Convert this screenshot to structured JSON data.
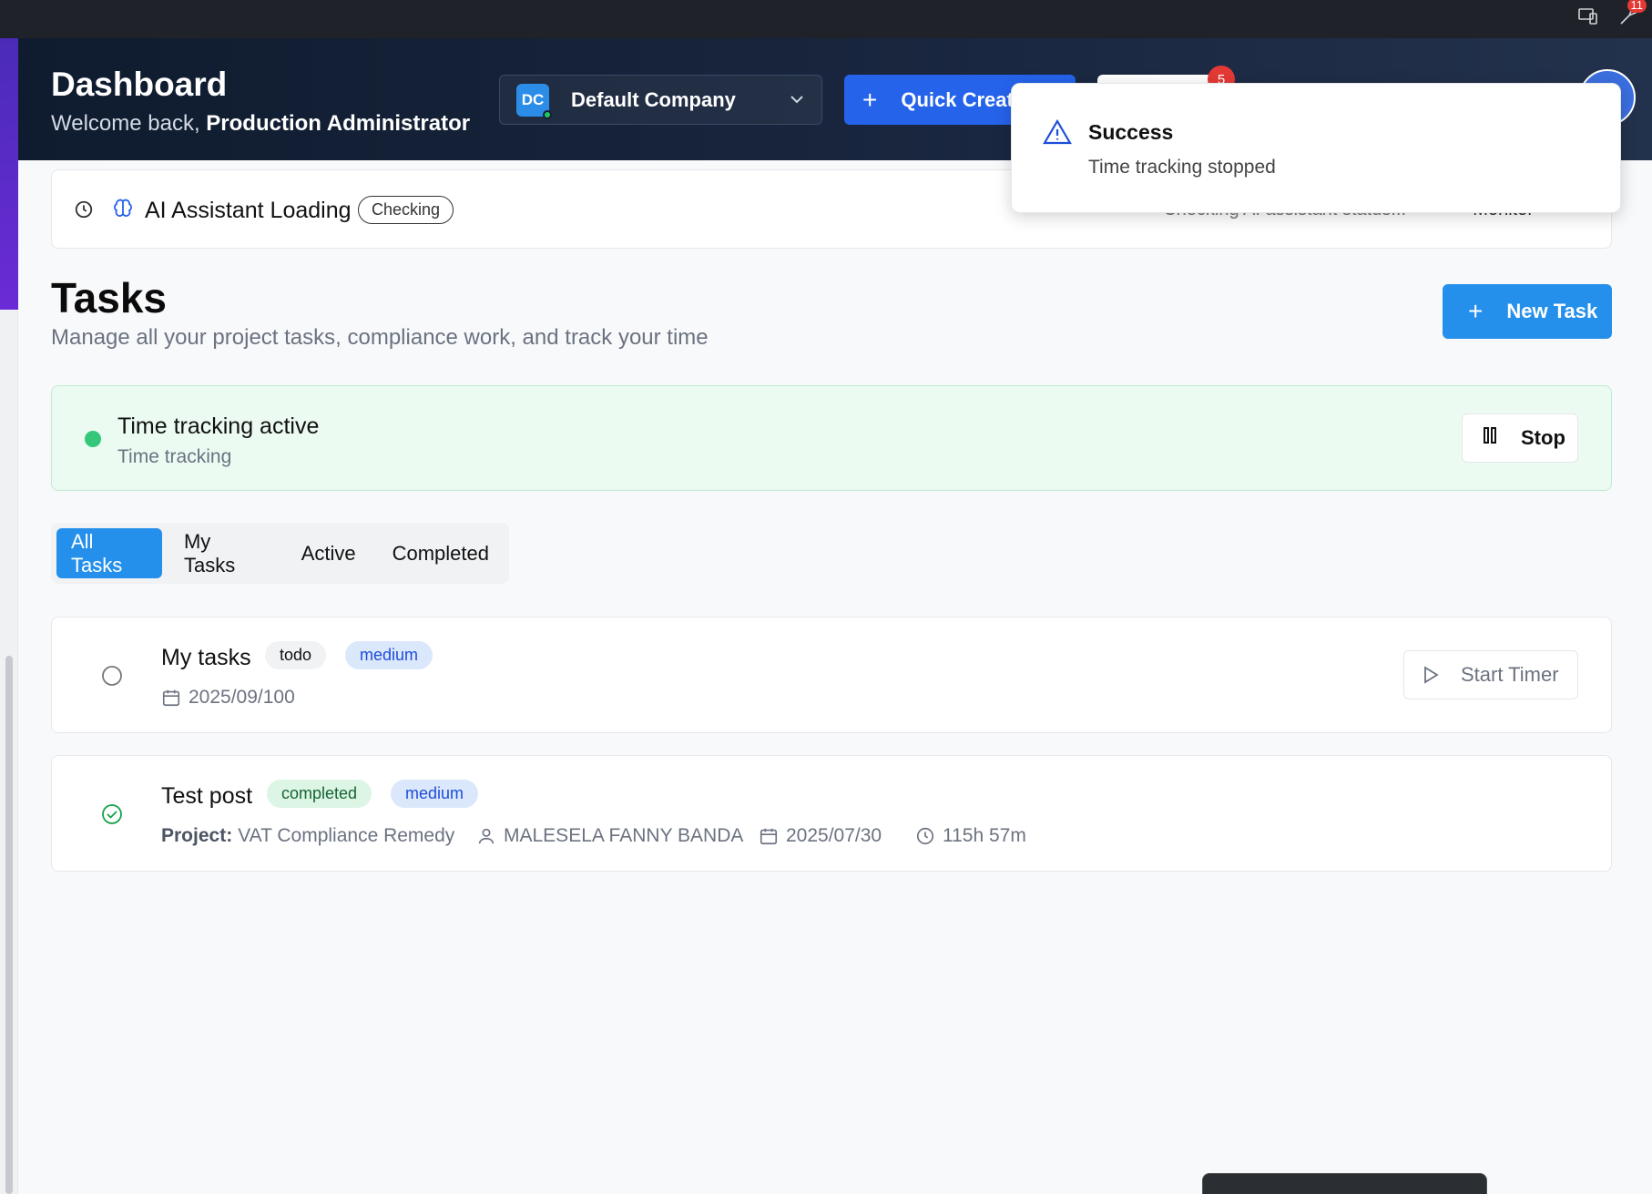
{
  "header": {
    "title": "Dashboard",
    "welcome_prefix": "Welcome back,",
    "user_name": "Production Administrator",
    "company_initials": "DC",
    "company_name": "Default Company",
    "quick_create": "Quick Create",
    "notification_count": "5"
  },
  "os": {
    "badge": "11"
  },
  "ai_bar": {
    "label": "AI Assistant Loading",
    "badge": "Checking",
    "status": "Checking AI assistant status...",
    "monitor": "Monitor"
  },
  "toast": {
    "title": "Success",
    "message": "Time tracking stopped"
  },
  "page": {
    "title": "Tasks",
    "subtitle": "Manage all your project tasks, compliance work, and track your time",
    "new_task": "New Task"
  },
  "tracking": {
    "title": "Time tracking active",
    "subtitle": "Time tracking",
    "stop": "Stop"
  },
  "tabs": [
    "All Tasks",
    "My Tasks",
    "Active",
    "Completed"
  ],
  "tasks": [
    {
      "name": "My tasks",
      "status": "todo",
      "priority": "medium",
      "date": "2025/09/100",
      "action": "Start Timer"
    },
    {
      "name": "Test post",
      "status": "completed",
      "priority": "medium",
      "project_label": "Project:",
      "project": "VAT Compliance Remedy",
      "assignee": "MALESELA FANNY BANDA",
      "date": "2025/07/30",
      "duration": "115h 57m"
    }
  ],
  "colors": {
    "primary": "#2590eb",
    "header_bg": "#0f1b2e",
    "success_bg": "#ecfbf2",
    "alert": "#e53935"
  }
}
